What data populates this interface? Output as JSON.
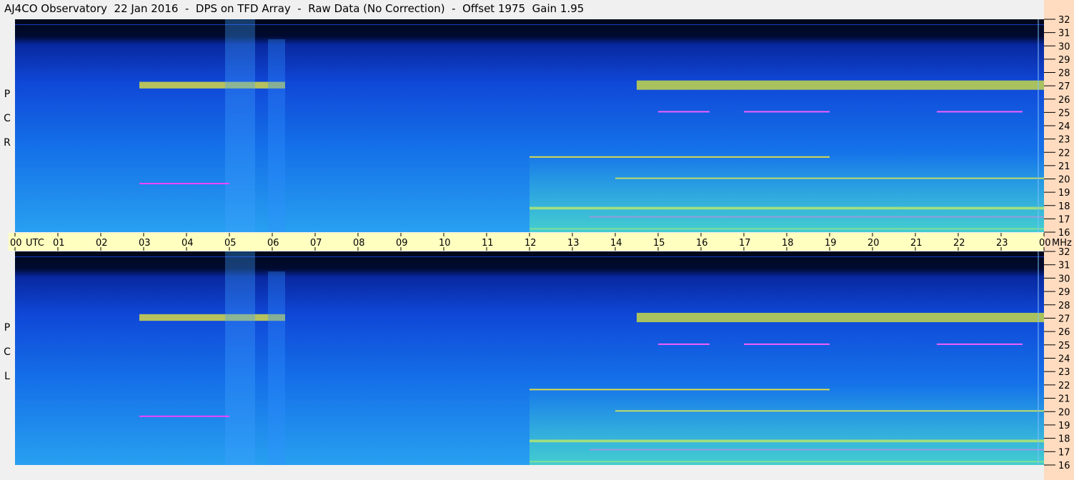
{
  "title": "AJ4CO Observatory  22 Jan 2016  -  DPS on TFD Array  -  Raw Data (No Correction)  -  Offset 1975  Gain 1.95",
  "panels": [
    {
      "label": [
        "R",
        "C",
        "P"
      ]
    },
    {
      "label": [
        "L",
        "C",
        "P"
      ]
    }
  ],
  "time_axis": {
    "ticks": [
      "00",
      "01",
      "02",
      "03",
      "04",
      "05",
      "06",
      "07",
      "08",
      "09",
      "10",
      "11",
      "12",
      "13",
      "14",
      "15",
      "16",
      "17",
      "18",
      "19",
      "20",
      "21",
      "22",
      "23",
      "00"
    ],
    "unit": "UTC"
  },
  "freq_axis": {
    "ticks": [
      32,
      31,
      30,
      29,
      28,
      27,
      26,
      25,
      24,
      23,
      22,
      21,
      20,
      19,
      18,
      17,
      16
    ],
    "unit": "MHz"
  },
  "colors": {
    "axis_band": "#ffffc0",
    "right_axis": "#ffdcc0",
    "background": "#f0f0f0",
    "dark": "#000818",
    "mid": "#1050e0",
    "high": "#30b0f0",
    "yellow": "#f0f040",
    "magenta": "#ff40ff"
  },
  "chart_data": {
    "type": "heatmap",
    "x_range_hours_utc": [
      0,
      24
    ],
    "y_range_mhz": [
      16,
      32
    ],
    "features": [
      {
        "kind": "band",
        "t": [
          2.9,
          6.3
        ],
        "f": [
          26.8,
          27.3
        ],
        "color": "#e0e040"
      },
      {
        "kind": "band",
        "t": [
          14.5,
          24.0
        ],
        "f": [
          26.7,
          27.4
        ],
        "color": "#d0e040"
      },
      {
        "kind": "burst",
        "t": [
          4.9,
          5.6
        ],
        "f": [
          16,
          32
        ],
        "color": "#40a0ff"
      },
      {
        "kind": "burst",
        "t": [
          5.9,
          6.3
        ],
        "f": [
          16,
          30.5
        ],
        "color": "#3090ff"
      },
      {
        "kind": "line",
        "t": [
          2.9,
          5.0
        ],
        "f": [
          19.6,
          19.7
        ],
        "color": "#ff40ff"
      },
      {
        "kind": "line",
        "t": [
          12.0,
          24.0
        ],
        "f": [
          17.7,
          17.9
        ],
        "color": "#f0e040"
      },
      {
        "kind": "line",
        "t": [
          13.4,
          24.0
        ],
        "f": [
          17.1,
          17.2
        ],
        "color": "#ff40ff"
      },
      {
        "kind": "line",
        "t": [
          14.0,
          24.0
        ],
        "f": [
          20.0,
          20.1
        ],
        "color": "#f0e040"
      },
      {
        "kind": "line",
        "t": [
          12.0,
          19.0
        ],
        "f": [
          21.6,
          21.7
        ],
        "color": "#f0e040"
      },
      {
        "kind": "line",
        "t": [
          15.0,
          16.2
        ],
        "f": [
          25.0,
          25.1
        ],
        "color": "#ff60ff"
      },
      {
        "kind": "line",
        "t": [
          17.0,
          19.0
        ],
        "f": [
          25.0,
          25.1
        ],
        "color": "#ff60ff"
      },
      {
        "kind": "line",
        "t": [
          21.5,
          23.5
        ],
        "f": [
          25.0,
          25.1
        ],
        "color": "#ff60ff"
      },
      {
        "kind": "line",
        "t": [
          12.0,
          24.0
        ],
        "f": [
          16.2,
          16.3
        ],
        "color": "#f0e040"
      },
      {
        "kind": "glow",
        "t": [
          12.0,
          24.0
        ],
        "f": [
          16.0,
          22.0
        ],
        "color": "#40d0d0"
      }
    ]
  }
}
